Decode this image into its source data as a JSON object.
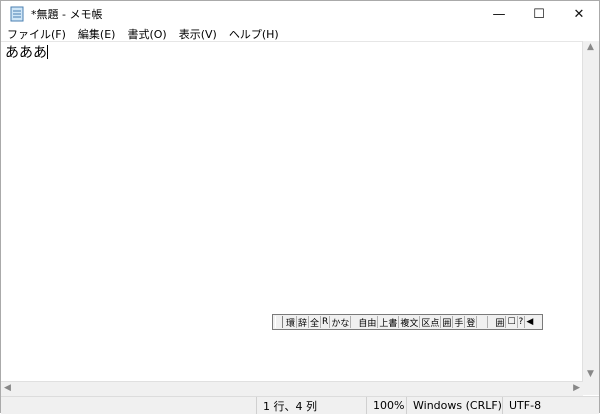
{
  "window": {
    "title": "*無題 - メモ帳",
    "controls": {
      "minimize": "—",
      "maximize": "☐",
      "close": "✕"
    }
  },
  "menu": [
    {
      "label": "ファイル(F)"
    },
    {
      "label": "編集(E)"
    },
    {
      "label": "書式(O)"
    },
    {
      "label": "表示(V)"
    },
    {
      "label": "ヘルプ(H)"
    }
  ],
  "editor": {
    "text": "あああ"
  },
  "ime_toolbar": {
    "buttons": [
      "環",
      "辞",
      "全",
      "R",
      "かな",
      "自由",
      "上書",
      "複文",
      "区点",
      "囲",
      "手",
      "登",
      "",
      "囲",
      "☐",
      "?",
      "◀"
    ]
  },
  "status": {
    "position": "1 行、4 列",
    "zoom": "100%",
    "line_ending": "Windows (CRLF)",
    "encoding": "UTF-8"
  },
  "icons": {
    "app": "notepad-icon",
    "scroll_up": "up-arrow-icon",
    "scroll_down": "down-arrow-icon",
    "scroll_left": "left-arrow-icon",
    "scroll_right": "right-arrow-icon"
  }
}
